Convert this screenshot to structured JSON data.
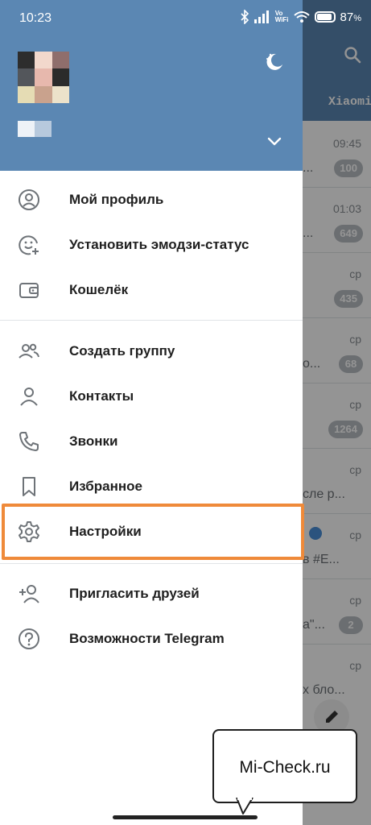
{
  "status_bar": {
    "time": "10:23",
    "vowifi_top": "Vo",
    "vowifi_bottom": "WiFi",
    "battery": "87",
    "battery_unit": "%"
  },
  "background_list": {
    "tab_label": "Xiaomi",
    "rows": [
      {
        "time": "09:45",
        "snippet": "...",
        "badge": "100"
      },
      {
        "time": "01:03",
        "snippet": "...",
        "badge": "649"
      },
      {
        "time": "ср",
        "snippet": "",
        "badge": "435"
      },
      {
        "time": "ср",
        "snippet": "о...",
        "badge": "68"
      },
      {
        "time": "ср",
        "snippet": "",
        "badge": "1264"
      },
      {
        "time": "ср",
        "snippet": "сле р...",
        "badge": ""
      },
      {
        "time": "ср",
        "snippet": "в #Е...",
        "badge": ""
      },
      {
        "time": "ср",
        "snippet": "а\"...",
        "badge": "2"
      },
      {
        "time": "ср",
        "snippet": "х бло...",
        "badge": ""
      }
    ]
  },
  "drawer": {
    "items_group1": [
      {
        "label": "Мой профиль",
        "icon": "profile-icon"
      },
      {
        "label": "Установить эмодзи-статус",
        "icon": "emoji-status-icon"
      },
      {
        "label": "Кошелёк",
        "icon": "wallet-icon"
      }
    ],
    "items_group2": [
      {
        "label": "Создать группу",
        "icon": "group-icon"
      },
      {
        "label": "Контакты",
        "icon": "contacts-icon"
      },
      {
        "label": "Звонки",
        "icon": "phone-icon"
      },
      {
        "label": "Избранное",
        "icon": "bookmark-icon"
      },
      {
        "label": "Настройки",
        "icon": "gear-icon"
      }
    ],
    "items_group3": [
      {
        "label": "Пригласить друзей",
        "icon": "add-user-icon"
      },
      {
        "label": "Возможности Telegram",
        "icon": "help-icon"
      }
    ]
  },
  "watermark": {
    "text": "Mi-Check.ru"
  },
  "colors": {
    "header": "#5b87b3",
    "highlight": "#ef8a3a",
    "badge": "#b9bec3"
  }
}
